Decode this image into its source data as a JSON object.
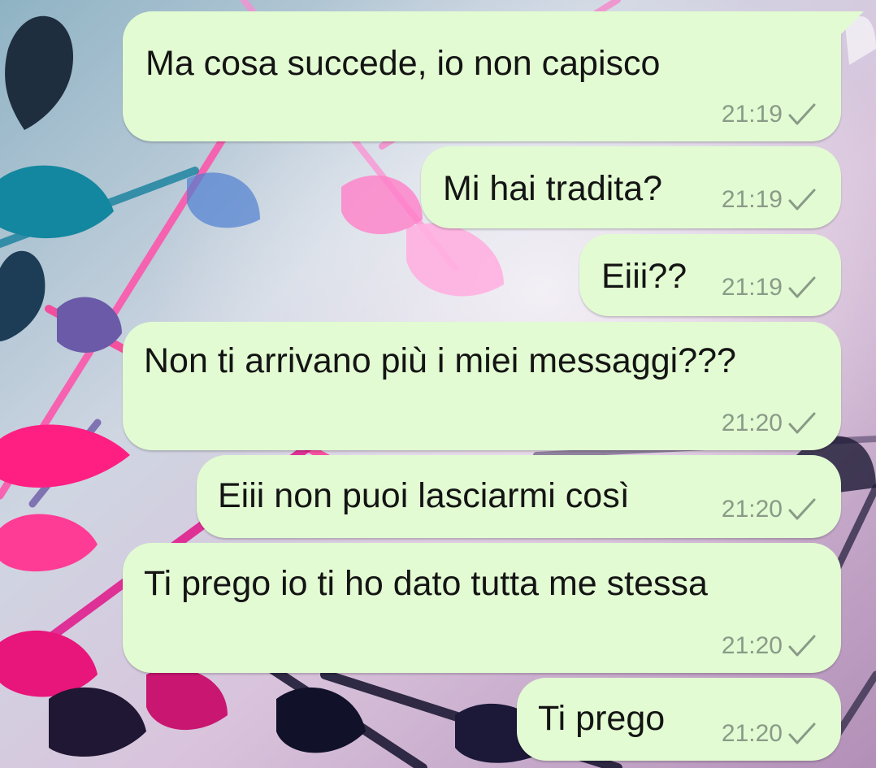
{
  "chat": {
    "messages": [
      {
        "text": "Ma cosa succede, io non capisco",
        "time": "21:19",
        "status_icon": "single-check-icon"
      },
      {
        "text": "Mi hai tradita?",
        "time": "21:19",
        "status_icon": "single-check-icon"
      },
      {
        "text": "Eiii??",
        "time": "21:19",
        "status_icon": "single-check-icon"
      },
      {
        "text": "Non ti arrivano più i miei messaggi???",
        "time": "21:20",
        "status_icon": "single-check-icon"
      },
      {
        "text": "Eiii non puoi lasciarmi così",
        "time": "21:20",
        "status_icon": "single-check-icon"
      },
      {
        "text": "Ti prego io ti ho dato tutta me stessa",
        "time": "21:20",
        "status_icon": "single-check-icon"
      },
      {
        "text": "Ti prego",
        "time": "21:20",
        "status_icon": "single-check-icon"
      }
    ]
  },
  "colors": {
    "bubble": "#e2fbd2",
    "text": "#141414",
    "meta": "#8a9a88"
  }
}
